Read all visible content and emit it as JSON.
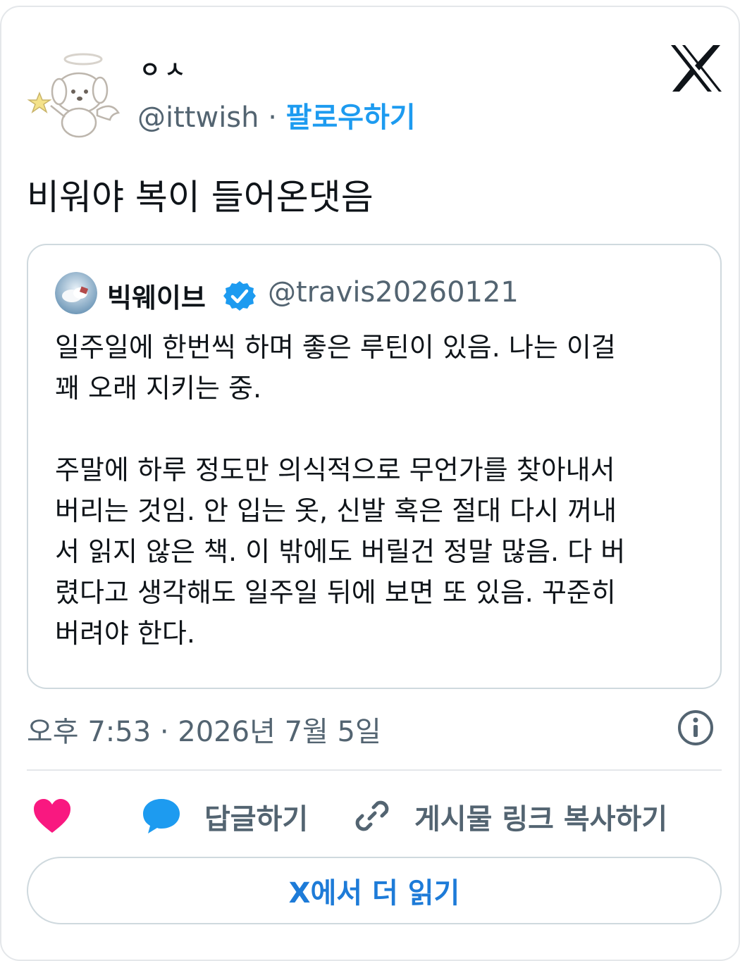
{
  "author": {
    "display_name": "ㅇㅅ",
    "handle": "@ittwish",
    "separator": "·",
    "follow_label": "팔로우하기"
  },
  "tweet": {
    "text": "비워야 복이 들어온댓음"
  },
  "quoted_tweet": {
    "display_name": "빅웨이브",
    "handle": "@travis20260121",
    "lines": [
      "일주일에 한번씩 하며 좋은 루틴이 있음. 나는 이걸",
      "꽤 오래 지키는 중.",
      "",
      "주말에 하루 정도만 의식적으로 무언가를 찾아내서",
      "버리는 것임. 안 입는 옷, 신발 혹은 절대 다시 꺼내",
      "서 읽지 않은 책. 이 밖에도 버릴건 정말 많음. 다 버",
      "렸다고 생각해도 일주일 뒤에 보면 또 있음. 꾸준히",
      "버려야 한다."
    ]
  },
  "meta": {
    "timestamp": "오후 7:53 · 2026년 7월 5일"
  },
  "actions": {
    "reply_label": "답글하기",
    "copy_link_label": "게시물 링크 복사하기",
    "read_more_label": "X에서 더 읽기"
  },
  "icons": {
    "brand": "x-logo-icon",
    "like": "heart-icon",
    "reply": "speech-bubble-icon",
    "link": "link-icon",
    "info": "info-icon",
    "verified": "verified-badge-icon"
  },
  "colors": {
    "accent": "#1d9bf0",
    "heart": "#f91880",
    "text_secondary": "#536471",
    "read_more": "#1d7bd8"
  }
}
